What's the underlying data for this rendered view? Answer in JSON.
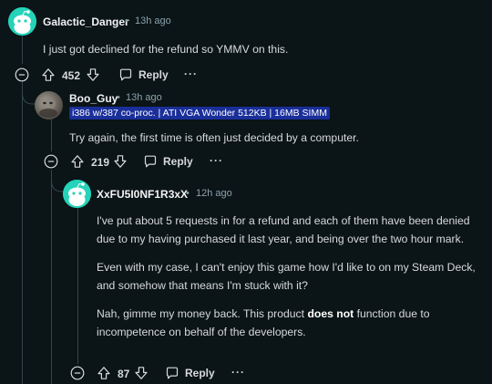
{
  "colors": {
    "background": "#0b1416",
    "thread_line": "#33464c",
    "flair_bg": "#1a2f9a",
    "snoo_teal": "#25d3b9",
    "meta_text": "#8ba2ad"
  },
  "comments": [
    {
      "username": "Galactic_Danger",
      "separator": "•",
      "time": "13h ago",
      "avatar": "snoo-teal-avatar",
      "body": [
        "I just got declined for the refund so YMMV on this."
      ],
      "votes": "452",
      "reply_label": "Reply",
      "more_label": "···"
    },
    {
      "username": "Boo_Guy",
      "separator": "•",
      "time": "13h ago",
      "avatar": "photo-avatar",
      "flair": "i386 w/387 co-proc. | ATI VGA Wonder 512KB | 16MB SIMM",
      "body": [
        "Try again, the first time is often just decided by a computer."
      ],
      "votes": "219",
      "reply_label": "Reply",
      "more_label": "···"
    },
    {
      "username": "XxFU5I0NF1R3xX",
      "separator": "•",
      "time": "12h ago",
      "avatar": "snoo-teal-avatar",
      "body": [
        "I've put about 5 requests in for a refund and each of them have been denied due to my having purchased it last year, and being over the two hour mark.",
        "Even with my case, I can't enjoy this game how I'd like to on my Steam Deck, and somehow that means I'm stuck with it?"
      ],
      "body_last_before": "Nah, gimme my money back. This product ",
      "body_last_bold": "does not",
      "body_last_after": " function due to incompetence on behalf of the developers.",
      "votes": "87",
      "reply_label": "Reply",
      "more_label": "···"
    }
  ]
}
